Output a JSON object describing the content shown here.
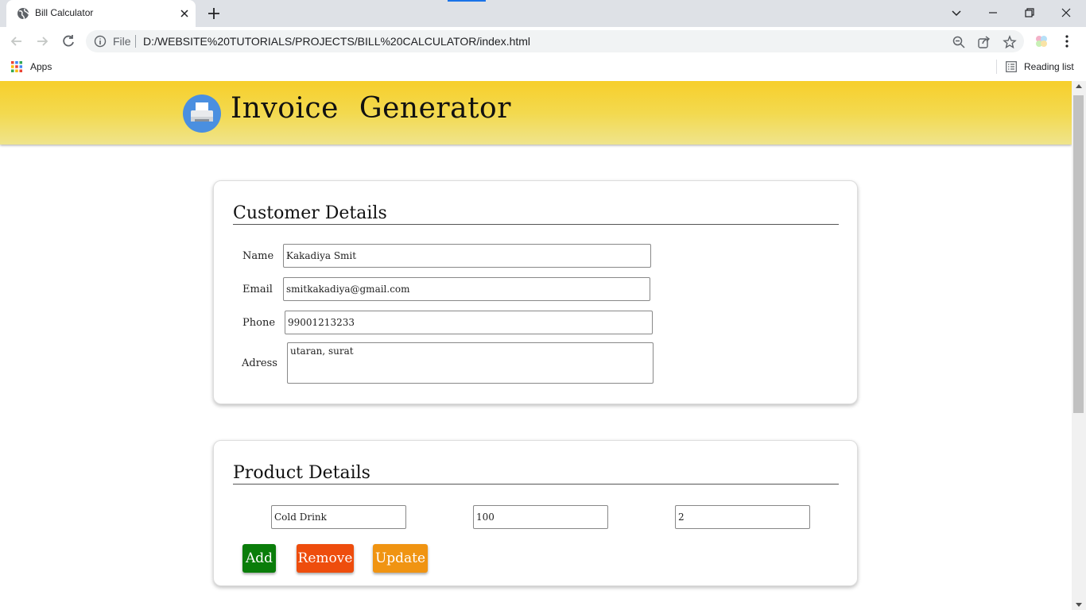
{
  "browser": {
    "tab_title": "Bill Calculator",
    "omnibox_scheme_label": "File",
    "url": "D:/WEBSITE%20TUTORIALS/PROJECTS/BILL%20CALCULATOR/index.html",
    "bookmarks": {
      "apps_label": "Apps",
      "reading_list_label": "Reading list"
    }
  },
  "header": {
    "title": "Invoice Generator"
  },
  "customer": {
    "heading": "Customer Details",
    "name_label": "Name",
    "name_value": "Kakadiya Smit",
    "email_label": "Email",
    "email_value": "smitkakadiya@gmail.com",
    "phone_label": "Phone",
    "phone_value": "99001213233",
    "address_label": "Adress",
    "address_value": "utaran, surat"
  },
  "product": {
    "heading": "Product Details",
    "product_name_value": "Cold Drink",
    "price_value": "100",
    "quantity_value": "2",
    "add_label": "Add",
    "remove_label": "Remove",
    "update_label": "Update"
  },
  "colors": {
    "header_gradient_top": "#f7cf2b",
    "add": "#0a7d0a",
    "remove": "#ee4d0d",
    "update": "#f09412"
  }
}
